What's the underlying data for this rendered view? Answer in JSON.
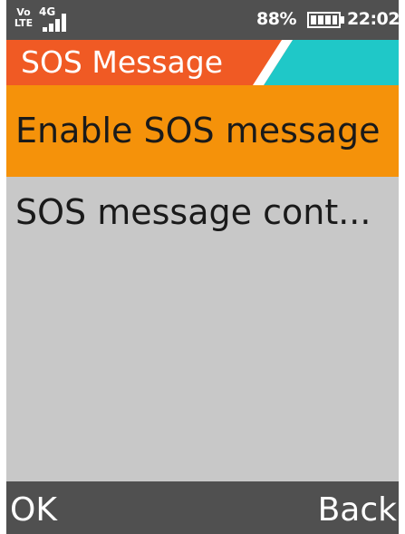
{
  "status_bar": {
    "volte_top": "Vo",
    "volte_bottom": "LTE",
    "network_type": "4G",
    "battery_percent": "88%",
    "time": "22:02"
  },
  "header": {
    "title": "SOS Message",
    "primary_color": "#f05a24",
    "accent_color": "#1fc8c8"
  },
  "menu": {
    "items": [
      {
        "label": "Enable SOS message",
        "selected": true
      },
      {
        "label": "SOS message cont...",
        "selected": false
      }
    ],
    "highlight_color": "#f5920a"
  },
  "softkeys": {
    "left": "OK",
    "right": "Back"
  }
}
